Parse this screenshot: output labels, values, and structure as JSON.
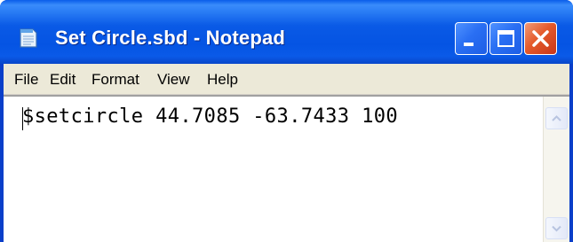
{
  "window": {
    "title": "Set Circle.sbd - Notepad",
    "icon": "notepad-icon"
  },
  "caption_buttons": {
    "minimize_icon": "minimize-icon",
    "maximize_icon": "maximize-icon",
    "close_icon": "close-icon"
  },
  "menu": {
    "items": [
      {
        "label": "File"
      },
      {
        "label": "Edit"
      },
      {
        "label": "Format"
      },
      {
        "label": "View"
      },
      {
        "label": "Help"
      }
    ]
  },
  "editor": {
    "text": "$setcircle 44.7085 -63.7433 100"
  },
  "scrollbar": {
    "up_icon": "scroll-up-arrow-icon",
    "down_icon": "scroll-down-arrow-icon"
  },
  "colors": {
    "titlebar": "#0554e3",
    "menubar": "#ece9d8",
    "close_button": "#e45a2b"
  }
}
